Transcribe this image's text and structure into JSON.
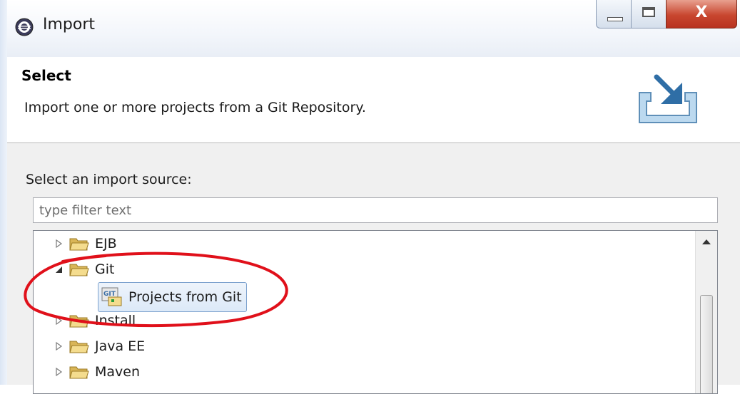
{
  "window": {
    "title": "Import",
    "close_glyph": "X",
    "controls": [
      "minimize-icon",
      "maximize-icon",
      "close-icon"
    ]
  },
  "banner": {
    "title": "Select",
    "description": "Import one or more projects from a Git Repository.",
    "icon": "import-wizard-icon"
  },
  "source": {
    "label": "Select an import source:",
    "filter_placeholder": "type filter text"
  },
  "tree": {
    "items": [
      {
        "label": "EJB",
        "state": "collapsed"
      },
      {
        "label": "Git",
        "state": "expanded"
      },
      {
        "label": "Projects from Git",
        "state": "selected"
      },
      {
        "label": "Install",
        "state": "collapsed"
      },
      {
        "label": "Java EE",
        "state": "collapsed"
      },
      {
        "label": "Maven",
        "state": "collapsed"
      }
    ]
  },
  "colors": {
    "selection_border": "#7da2ce",
    "annotation": "#e0101a",
    "folder": "#e8c66a",
    "close_button": "#c8462f"
  }
}
